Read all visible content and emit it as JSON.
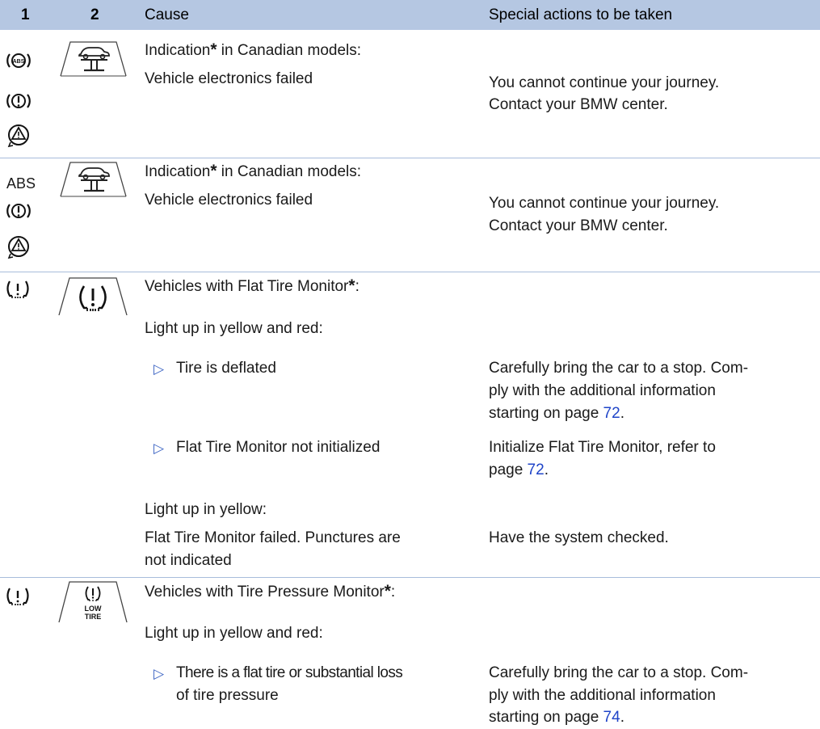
{
  "header": {
    "col1": "1",
    "col2": "2",
    "col3": "Cause",
    "col4": "Special actions to be taken"
  },
  "rows": [
    {
      "col1_icons": [
        "abs-circle-icon",
        "exclamation-circle-icon",
        "triangle-circle-icon"
      ],
      "col2_icon": "vehicle-lift-icon",
      "indication_prefix": "Indication",
      "asterisk": "*",
      "indication_suffix": " in Canadian models:",
      "cause": "Vehicle electronics failed",
      "action_line1": "You cannot continue your journey.",
      "action_line2": "Contact your BMW center."
    },
    {
      "col1_abs_text": "ABS",
      "col1_icons": [
        "exclamation-circle-icon",
        "triangle-circle-icon"
      ],
      "col2_icon": "vehicle-lift-icon",
      "indication_prefix": "Indication",
      "asterisk": "*",
      "indication_suffix": " in Canadian models:",
      "cause": "Vehicle electronics failed",
      "action_line1": "You cannot continue your journey.",
      "action_line2": "Contact your BMW center."
    },
    {
      "col1_icon": "tire-warning-icon",
      "col2_icon": "tire-warning-icon",
      "heading_prefix": "Vehicles with Flat Tire Monitor",
      "asterisk": "*",
      "heading_suffix": ":",
      "sub1": "Light up in yellow and red:",
      "bullet1": "Tire is deflated",
      "bullet1_action_line1": "Carefully bring the car to a stop. Com-",
      "bullet1_action_line2": "ply with the additional information",
      "bullet1_action_line3_prefix": "starting on page ",
      "bullet1_action_page": "72",
      "bullet1_action_suffix": ".",
      "bullet2": "Flat Tire Monitor not initialized",
      "bullet2_action_line1": "Initialize Flat Tire Monitor, refer to",
      "bullet2_action_line2_prefix": "page ",
      "bullet2_action_page": "72",
      "bullet2_action_suffix": ".",
      "sub2": "Light up in yellow:",
      "cause2_line1": "Flat Tire Monitor failed. Punctures are",
      "cause2_line2": "not indicated",
      "action2": "Have the system checked."
    },
    {
      "col1_icon": "tire-warning-icon",
      "col2_icon": "low-tire-icon",
      "col2_icon_text_1": "LOW",
      "col2_icon_text_2": "TIRE",
      "heading_prefix": "Vehicles with Tire Pressure Monitor",
      "asterisk": "*",
      "heading_suffix": ":",
      "sub1": "Light up in yellow and red:",
      "bullet1_line1": "There is a flat tire or substantial loss",
      "bullet1_line2": "of tire pressure",
      "bullet1_action_line1": "Carefully bring the car to a stop. Com-",
      "bullet1_action_line2": "ply with the additional information",
      "bullet1_action_line3_prefix": "starting on page ",
      "bullet1_action_page": "74",
      "bullet1_action_suffix": "."
    }
  ],
  "bullet_symbol": "▷"
}
